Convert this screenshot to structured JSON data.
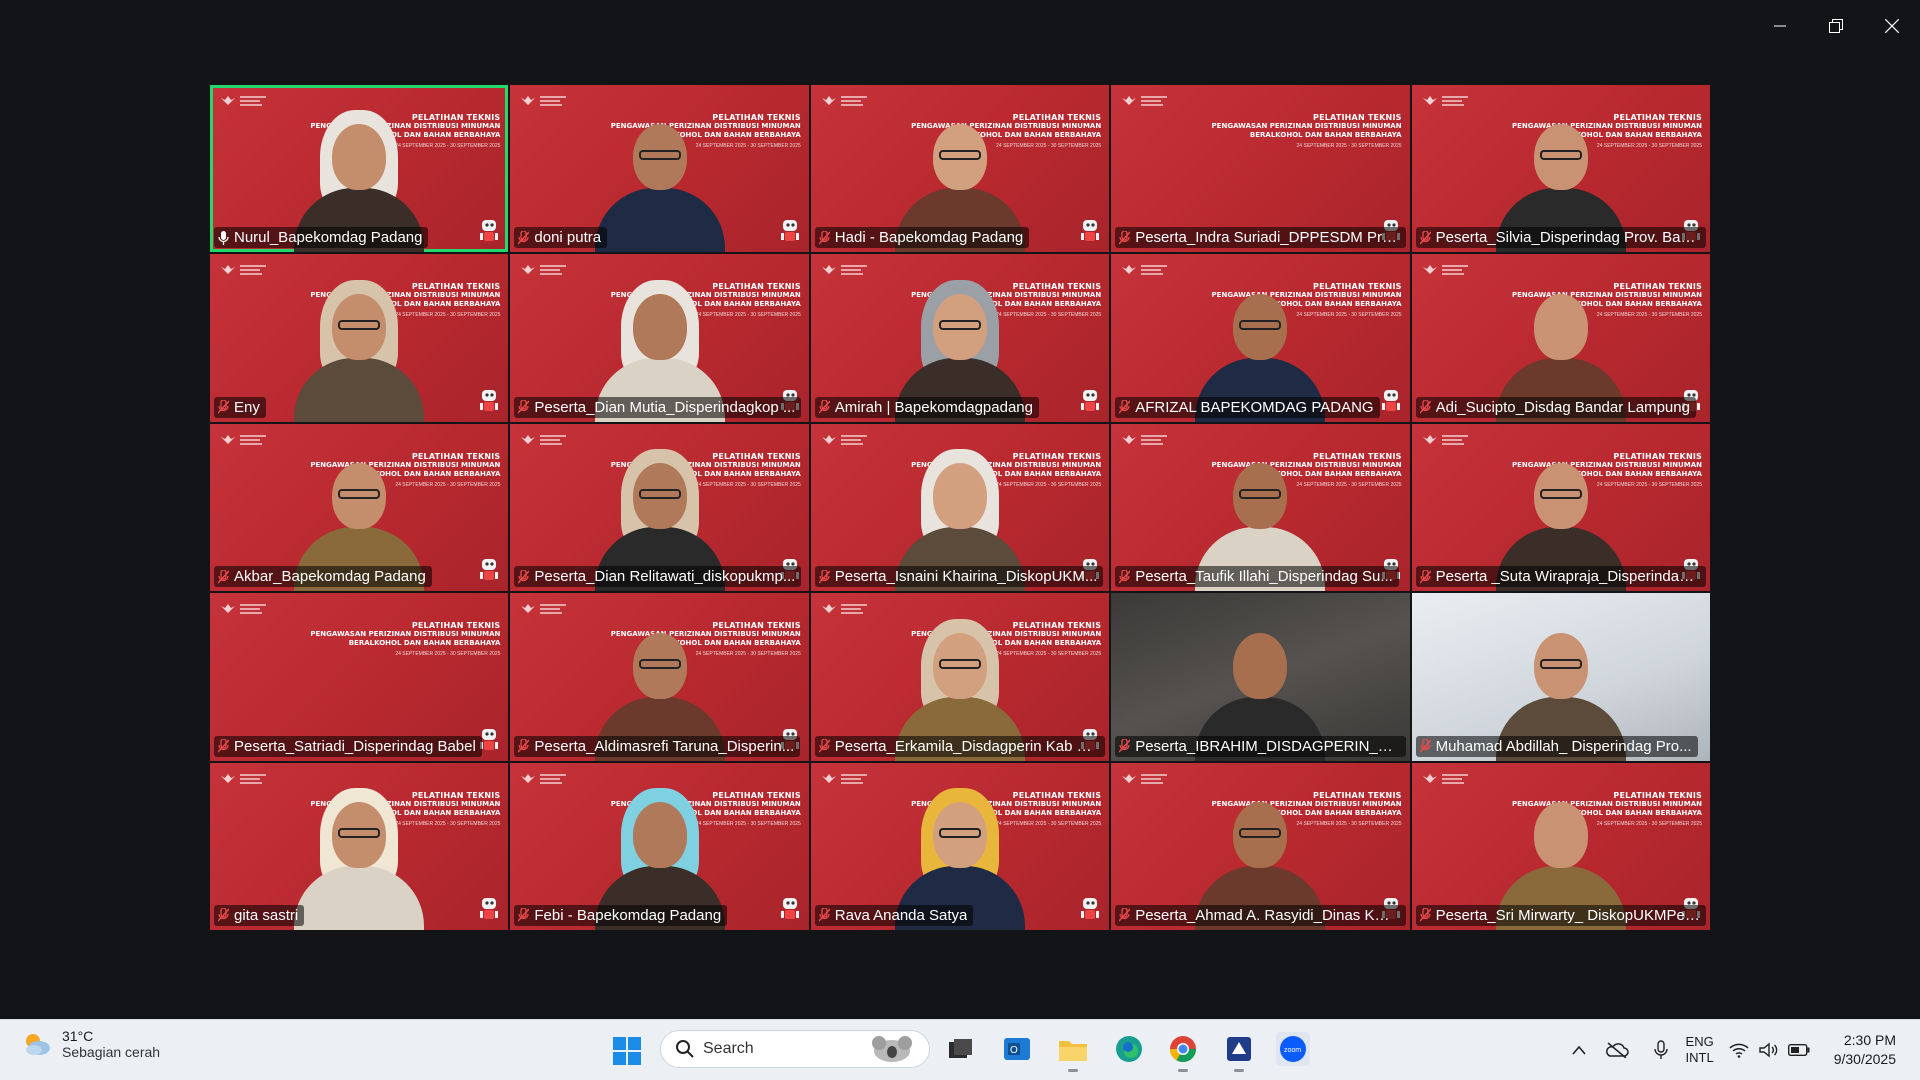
{
  "window": {
    "controls": {
      "minimize_icon": "minimize-icon",
      "restore_icon": "restore-icon",
      "close_icon": "close-icon"
    }
  },
  "banner": {
    "title": "PELATIHAN TEKNIS",
    "line2": "PENGAWASAN PERIZINAN DISTRIBUSI MINUMAN",
    "line3": "BERALKOHOL DAN BAHAN BERBAHAYA",
    "dates": "24 SEPTEMBER 2025 - 30 SEPTEMBER 2025"
  },
  "colors": {
    "tile_bg": "#c6333a",
    "active_border": "#23d96b",
    "taskbar_bg": "#ecf0f5"
  },
  "participants": [
    {
      "name": "Nurul_Bapekomdag Padang",
      "active": true,
      "mic": "speaking"
    },
    {
      "name": "doni putra",
      "mic": "muted"
    },
    {
      "name": "Hadi - Bapekomdag Padang",
      "mic": "muted"
    },
    {
      "name": "Peserta_Indra Suriadi_DPPESDM Pro...",
      "mic": "muted",
      "no_face": true
    },
    {
      "name": "Peserta_Silvia_Disperindag Prov. Babel",
      "mic": "muted"
    },
    {
      "name": "Eny",
      "mic": "muted"
    },
    {
      "name": "Peserta_Dian Mutia_Disperindagkop ...",
      "mic": "muted"
    },
    {
      "name": "Amirah | Bapekomdagpadang",
      "mic": "muted"
    },
    {
      "name": "AFRIZAL BAPEKOMDAG PADANG",
      "mic": "muted"
    },
    {
      "name": "Adi_Sucipto_Disdag Bandar Lampung",
      "mic": "muted"
    },
    {
      "name": "Akbar_Bapekomdag Padang",
      "mic": "muted"
    },
    {
      "name": "Peserta_Dian Relitawati_diskopukmp...",
      "mic": "muted"
    },
    {
      "name": "Peserta_Isnaini Khairina_DiskopUKM...",
      "mic": "muted"
    },
    {
      "name": "Peserta_Taufik Illahi_Disperindag Su...",
      "mic": "muted"
    },
    {
      "name": "Peserta _Suta Wiraprajа_Disperindag ...",
      "mic": "muted"
    },
    {
      "name": "Peserta_Satriadi_Disperindag Babel",
      "mic": "muted",
      "no_face": true
    },
    {
      "name": "Peserta_Aldimasrefi Taruna_Disperin...",
      "mic": "muted"
    },
    {
      "name": "Peserta_Erkamila_Disdagperin Kab Be...",
      "mic": "muted"
    },
    {
      "name": "Peserta_IBRAHIM_DISDAGPERIN_KA...",
      "mic": "muted",
      "bg": "plain"
    },
    {
      "name": "Muhamad Abdillah_ Disperindag Pro...",
      "mic": "muted",
      "bg": "room"
    },
    {
      "name": "gita sastri",
      "mic": "muted"
    },
    {
      "name": "Febi - Bapekomdag Padang",
      "mic": "muted"
    },
    {
      "name": "Rava Ananda Satya",
      "mic": "muted"
    },
    {
      "name": "Peserta_Ahmad A. Rasyidi_Dinas KUK...",
      "mic": "muted"
    },
    {
      "name": "Peserta_Sri Mirwarty_ DiskopUKMPeri...",
      "mic": "muted"
    }
  ],
  "taskbar": {
    "weather": {
      "temp": "31°C",
      "condition": "Sebagian cerah",
      "icon": "partly-cloudy-icon"
    },
    "search_label": "Search",
    "apps": [
      "task-view-icon",
      "outlook-icon",
      "file-explorer-icon",
      "edge-icon",
      "chrome-icon",
      "app-icon",
      "zoom-icon"
    ],
    "tray": {
      "lang_line1": "ENG",
      "lang_line2": "INTL",
      "time": "2:30 PM",
      "date": "9/30/2025"
    }
  }
}
